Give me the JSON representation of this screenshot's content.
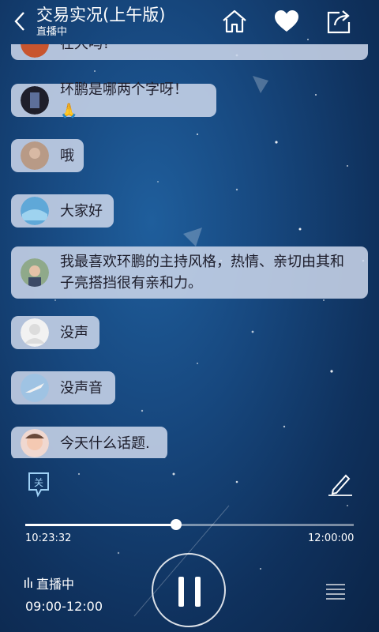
{
  "header": {
    "title": "交易实况(上午版)",
    "subtitle": "直播中",
    "icons": [
      "back-icon",
      "home-icon",
      "heart-icon",
      "share-icon"
    ]
  },
  "messages": [
    {
      "text": "在大吗?",
      "avatar": "avatar-orange"
    },
    {
      "text": "环鹏是哪两个字呀！🙏",
      "avatar": "avatar-dark"
    },
    {
      "text": "哦",
      "avatar": "avatar-tan"
    },
    {
      "text": "大家好",
      "avatar": "avatar-blue"
    },
    {
      "text": "我最喜欢环鹏的主持风格，热情、亲切由其和子亮搭挡很有亲和力。",
      "avatar": "avatar-photo"
    },
    {
      "text": "没声",
      "avatar": "avatar-default"
    },
    {
      "text": "没声音",
      "avatar": "avatar-plane"
    },
    {
      "text": "今天什么话题.",
      "avatar": "avatar-child"
    }
  ],
  "controls": {
    "follow_icon_label": "关",
    "progress_fraction": 0.46,
    "time_current": "10:23:32",
    "time_end": "12:00:00",
    "live_label": "直播中",
    "schedule": "09:00-12:00"
  },
  "colors": {
    "bubble_bg": "#cdd7eb",
    "background_top": "#1f5e9c",
    "background_bottom": "#0b2447"
  }
}
